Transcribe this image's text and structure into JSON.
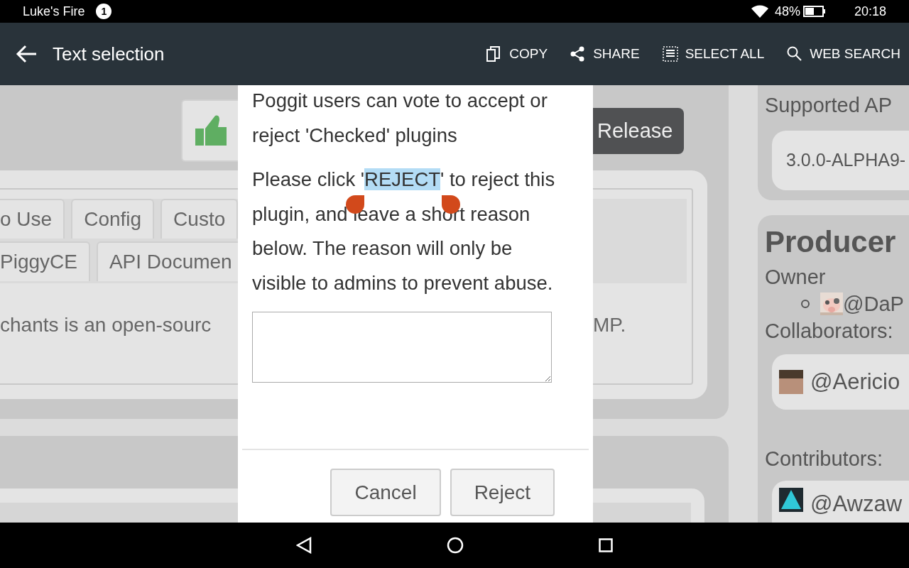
{
  "status_bar": {
    "device_name": "Luke's Fire",
    "notification_count": "1",
    "battery": "48%",
    "time": "20:18"
  },
  "app_bar": {
    "title": "Text selection",
    "actions": [
      {
        "label": "COPY",
        "kind": "copy"
      },
      {
        "label": "SHARE",
        "kind": "share"
      },
      {
        "label": "SELECT ALL",
        "kind": "select_all"
      },
      {
        "label": "WEB SEARCH",
        "kind": "search"
      }
    ]
  },
  "page": {
    "release_button": "Release",
    "tabs": [
      {
        "label": "o Use"
      },
      {
        "label": "Config"
      },
      {
        "label": "Custo"
      }
    ],
    "tabs_row_2": [
      {
        "label": "PiggyCE"
      },
      {
        "label": "API Documen"
      }
    ],
    "description_start": "chants is an open-sourc",
    "description_end": "MP.",
    "supported_api": {
      "title": "Supported AP",
      "value": "3.0.0-ALPHA9-"
    },
    "producers": {
      "title": "Producer",
      "owner_label": "Owner",
      "owner": {
        "name": "@DaP"
      },
      "collaborators_label": "Collaborators:",
      "collaborators": [
        {
          "name": "@Aericio"
        }
      ],
      "contributors_label": "Contributors:",
      "contributors": [
        {
          "name": "@Awzaw"
        }
      ]
    }
  },
  "dialog": {
    "intro": "Poggit users can vote to accept or reject 'Checked' plugins",
    "instruction": {
      "before": "Please click '",
      "selected": "REJECT",
      "after": "' to reject this plugin, and leave a short reason below. The reason will only be visible to admins to prevent abuse."
    },
    "buttons": [
      {
        "label": "Cancel"
      },
      {
        "label": "Reject"
      }
    ]
  }
}
